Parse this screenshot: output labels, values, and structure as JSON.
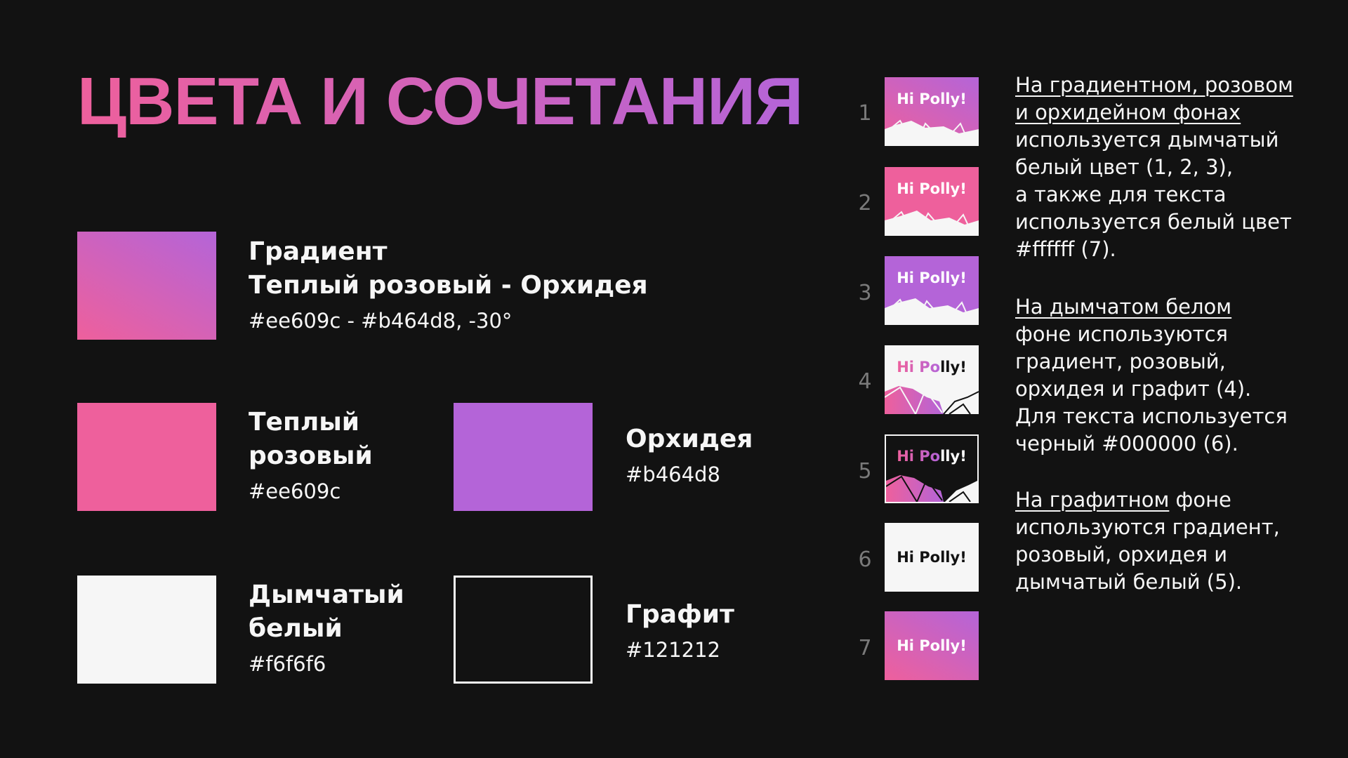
{
  "title": "ЦВЕТА И СОЧЕТАНИЯ",
  "colors": {
    "pink": "#ee609c",
    "orchid": "#b464d8",
    "smoke_white": "#f6f6f6",
    "graphite": "#121212"
  },
  "swatches": {
    "gradient": {
      "line1": "Градиент",
      "line2": "Теплый розовый - Орхидея",
      "code": "#ee609c - #b464d8, -30°"
    },
    "pink": {
      "line1": "Теплый",
      "line2": "розовый",
      "code": "#ee609c"
    },
    "orchid": {
      "line1": "Орхидея",
      "code": "#b464d8"
    },
    "smoke": {
      "line1": "Дымчатый",
      "line2": "белый",
      "code": "#f6f6f6"
    },
    "graphite": {
      "line1": "Графит",
      "code": "#121212"
    }
  },
  "examples": [
    {
      "num": "1",
      "label": "Hi Polly!"
    },
    {
      "num": "2",
      "label": "Hi Polly!"
    },
    {
      "num": "3",
      "label": "Hi Polly!"
    },
    {
      "num": "4",
      "label_a": "Hi Po",
      "label_b": "lly!"
    },
    {
      "num": "5",
      "label_a": "Hi Po",
      "label_b": "lly!"
    },
    {
      "num": "6",
      "label": "Hi Polly!"
    },
    {
      "num": "7",
      "label": "Hi Polly!"
    }
  ],
  "descriptions": {
    "p1": {
      "u1": "На градиентном, розовом",
      "u2": "и орхидейном фонах",
      "l3": "используется дымчатый",
      "l4": "белый цвет (1, 2, 3),",
      "l5": "а также для текста",
      "l6": "используется белый цвет",
      "l7": "#ffffff (7)."
    },
    "p2": {
      "u1": "На дымчатом белом",
      "l2": "фоне используются",
      "l3": "градиент, розовый,",
      "l4": "орхидея и графит (4).",
      "l5": "Для текста используется",
      "l6": "черный #000000 (6)."
    },
    "p3": {
      "u1": "На графитном",
      "t1": " фоне",
      "l2": "используются градиент,",
      "l3": "розовый, орхидея и",
      "l4": "дымчатый белый (5)."
    }
  }
}
